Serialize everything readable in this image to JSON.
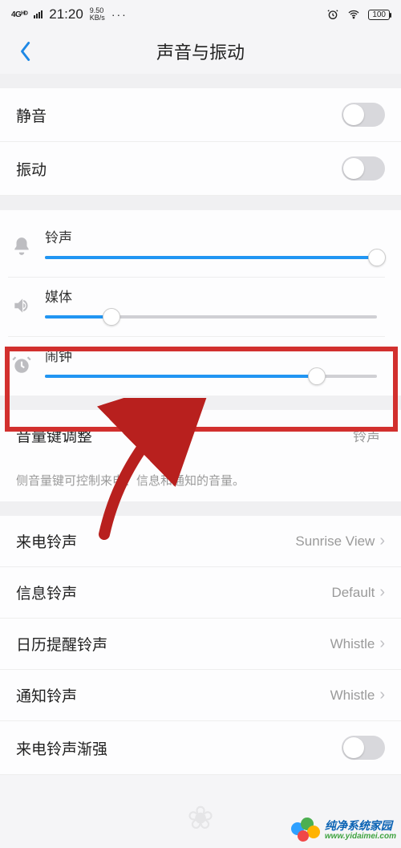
{
  "status": {
    "network": "4Gᴴᴰ",
    "time": "21:20",
    "speed_top": "9.50",
    "speed_bottom": "KB/s",
    "dots": "···",
    "battery": "100"
  },
  "header": {
    "title": "声音与振动"
  },
  "toggles": {
    "mute_label": "静音",
    "vibrate_label": "振动"
  },
  "sliders": {
    "ring_label": "铃声",
    "ring_pct": 100,
    "media_label": "媒体",
    "media_pct": 20,
    "alarm_label": "闹钟",
    "alarm_pct": 82
  },
  "volkey": {
    "label": "音量键调整",
    "value": "铃声",
    "desc": "侧音量键可控制来电、信息和通知的音量。"
  },
  "ringtones": {
    "incoming": {
      "label": "来电铃声",
      "value": "Sunrise View"
    },
    "message": {
      "label": "信息铃声",
      "value": "Default"
    },
    "calendar": {
      "label": "日历提醒铃声",
      "value": "Whistle"
    },
    "notify": {
      "label": "通知铃声",
      "value": "Whistle"
    },
    "fadein": {
      "label": "来电铃声渐强"
    }
  },
  "watermark": {
    "name": "纯净系统家园",
    "url": "www.yidaimei.com"
  }
}
